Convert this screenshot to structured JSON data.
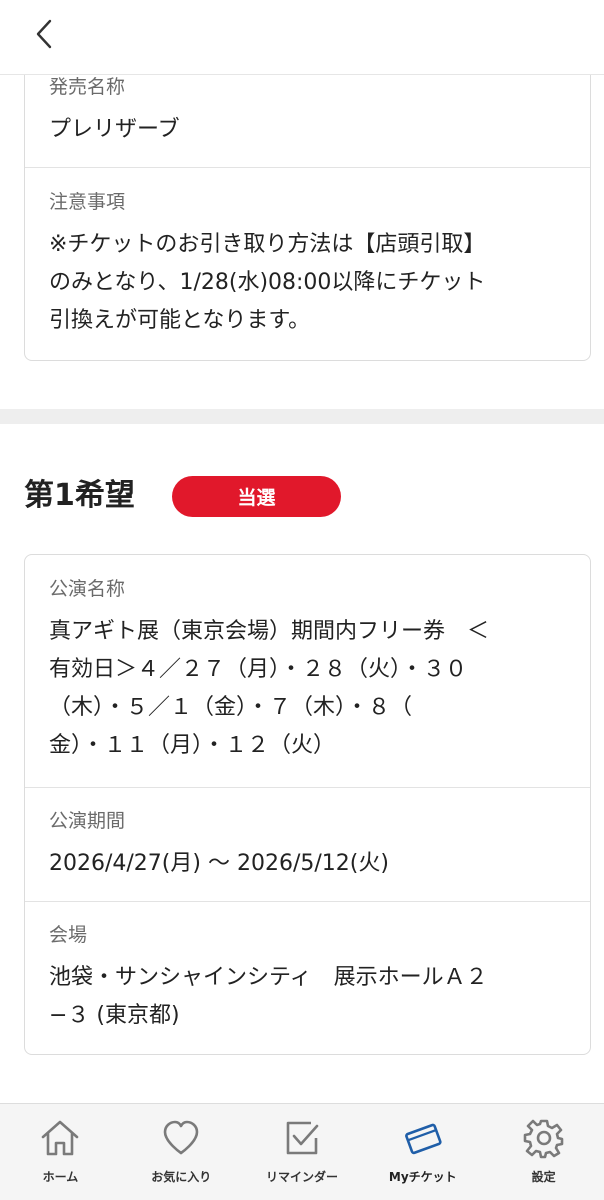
{
  "header": {
    "back_icon": "chevron-left-icon"
  },
  "sale_card": {
    "sale_name_label": "発売名称",
    "sale_name_value": "プレリザーブ",
    "notes_label": "注意事項",
    "notes_lines": [
      "※チケットのお引き取り方法は【店頭引取】",
      "のみとなり、1/28(水)08:00以降にチケット",
      "引換えが可能となります。"
    ]
  },
  "choice": {
    "title": "第1希望",
    "status": "当選",
    "status_color": "#e1182b"
  },
  "performance_card": {
    "name_label": "公演名称",
    "name_lines": [
      "真アギト展（東京会場）期間内フリー券　＜",
      "有効日＞４／２７（月）・２８（火）・３０",
      "（木）・５／１（金）・７（木）・８（",
      "金）・１１（月）・１２（火）"
    ],
    "period_label": "公演期間",
    "period_value": "2026/4/27(月) 〜 2026/5/12(火)",
    "venue_label": "会場",
    "venue_lines": [
      "池袋・サンシャインシティ　展示ホールＡ２",
      "−３ (東京都)"
    ]
  },
  "bottom_nav": {
    "items": [
      {
        "label": "ホーム",
        "icon": "home-icon"
      },
      {
        "label": "お気に入り",
        "icon": "heart-icon"
      },
      {
        "label": "リマインダー",
        "icon": "checkbox-icon"
      },
      {
        "label": "Myチケット",
        "icon": "ticket-icon",
        "active": true
      },
      {
        "label": "設定",
        "icon": "gear-icon"
      }
    ],
    "active_color": "#1f5ea8"
  }
}
